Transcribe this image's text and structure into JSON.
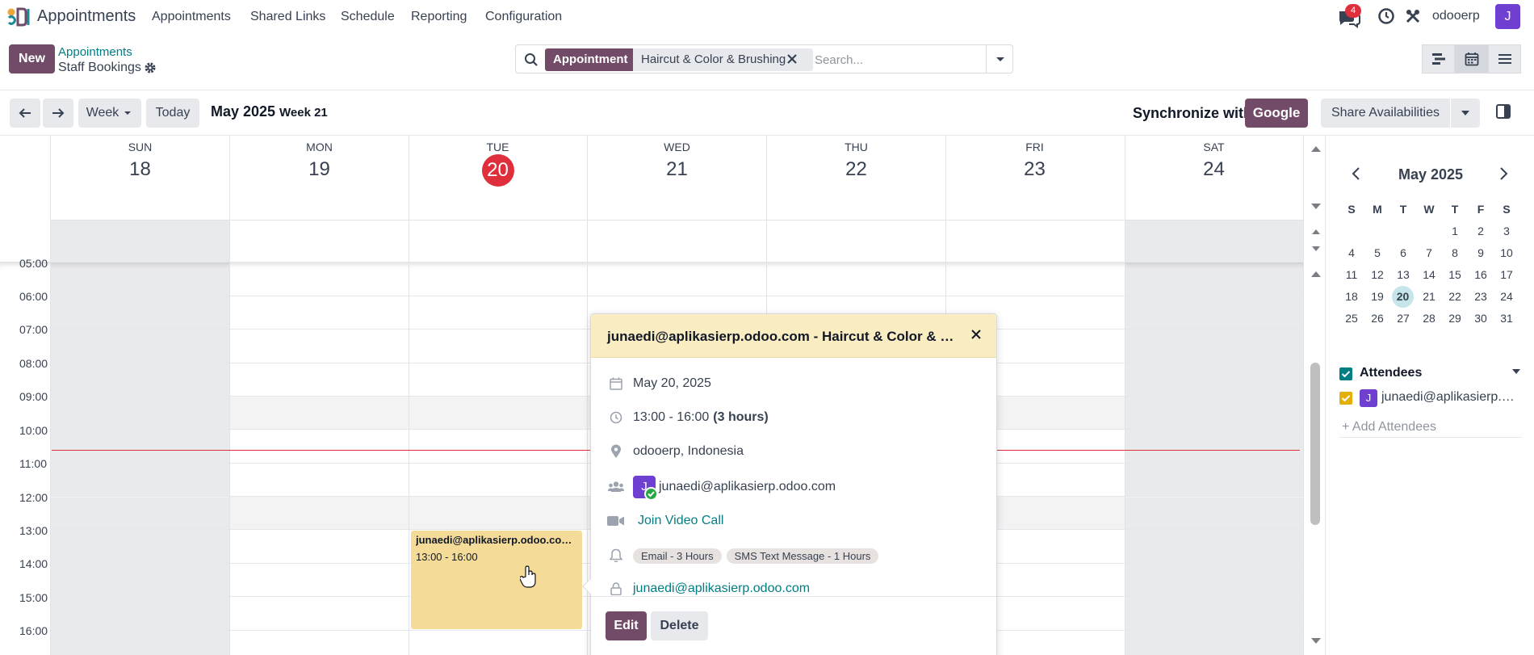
{
  "topnav": {
    "app_name": "Appointments",
    "menu": [
      "Appointments",
      "Shared Links",
      "Schedule",
      "Reporting",
      "Configuration"
    ],
    "chat_badge": "4",
    "company": "odooerp",
    "user_initial": "J"
  },
  "control": {
    "new_label": "New",
    "breadcrumb_parent": "Appointments",
    "breadcrumb_current": "Staff Bookings",
    "search": {
      "facet_label": "Appointment",
      "facet_value": "Haircut & Color & Brushing",
      "placeholder": "Search..."
    }
  },
  "toolbar": {
    "scale_label": "Week",
    "today_label": "Today",
    "period": "May 2025",
    "week_no": "Week 21",
    "sync_label": "Synchronize with",
    "google_label": "Google",
    "share_label": "Share Availabilities"
  },
  "calendar": {
    "days": [
      {
        "name": "SUN",
        "num": "18"
      },
      {
        "name": "MON",
        "num": "19"
      },
      {
        "name": "TUE",
        "num": "20"
      },
      {
        "name": "WED",
        "num": "21"
      },
      {
        "name": "THU",
        "num": "22"
      },
      {
        "name": "FRI",
        "num": "23"
      },
      {
        "name": "SAT",
        "num": "24"
      }
    ],
    "today_index": 2,
    "hours": [
      "05:00",
      "06:00",
      "07:00",
      "08:00",
      "09:00",
      "10:00",
      "11:00",
      "12:00",
      "13:00",
      "14:00",
      "15:00",
      "16:00"
    ],
    "event": {
      "title": "junaedi@aplikasierp.odoo.com - Haircut & Color & Brushing",
      "time": "13:00 - 16:00"
    }
  },
  "popover": {
    "title": "junaedi@aplikasierp.odoo.com - Haircut & Color & Brushing",
    "date": "May 20, 2025",
    "time_range": "13:00 - 16:00",
    "duration": "(3 hours)",
    "location": "odooerp, Indonesia",
    "attendee_initial": "J",
    "attendee": "junaedi@aplikasierp.odoo.com",
    "video_call": "Join Video Call",
    "alarms": [
      "Email - 3 Hours",
      "SMS Text Message - 1 Hours"
    ],
    "organizer": "junaedi@aplikasierp.odoo.com",
    "edit_label": "Edit",
    "delete_label": "Delete"
  },
  "mini_calendar": {
    "title": "May 2025",
    "dow": [
      "S",
      "M",
      "T",
      "W",
      "T",
      "F",
      "S"
    ],
    "weeks": [
      [
        "",
        "",
        "",
        "",
        "1",
        "2",
        "3"
      ],
      [
        "4",
        "5",
        "6",
        "7",
        "8",
        "9",
        "10"
      ],
      [
        "11",
        "12",
        "13",
        "14",
        "15",
        "16",
        "17"
      ],
      [
        "18",
        "19",
        "20",
        "21",
        "22",
        "23",
        "24"
      ],
      [
        "25",
        "26",
        "27",
        "28",
        "29",
        "30",
        "31"
      ]
    ],
    "today": "20"
  },
  "attendees": {
    "title": "Attendees",
    "items": [
      {
        "initial": "J",
        "name": "junaedi@aplikasierp.odoo.com"
      }
    ],
    "add_label": "+ Add Attendees"
  },
  "colors": {
    "brand": "#714b67",
    "today": "#e02f3c",
    "event": "#f4dc98",
    "link": "#017e84"
  }
}
